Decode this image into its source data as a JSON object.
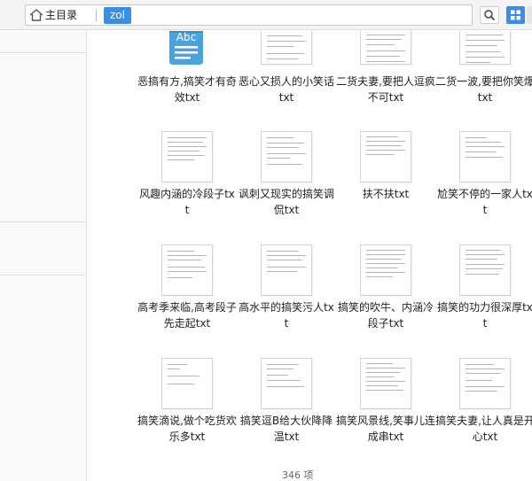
{
  "toolbar": {
    "home_icon": "home-icon",
    "crumb_home": "主目录",
    "crumb_current": "zol",
    "search_icon": "search-icon",
    "view_icon": "grid-view-icon",
    "accent": "#3a8ee6"
  },
  "files": [
    {
      "name": "恶搞有方,搞笑才有奇效txt",
      "icon": "text-file-abc-icon"
    },
    {
      "name": "恶心又损人的小笑话txt",
      "icon": "text-file-thumbnail"
    },
    {
      "name": "二货夫妻,要把人逗疯不可txt",
      "icon": "text-file-thumbnail"
    },
    {
      "name": "二货一波,要把你笑爆txt",
      "icon": "text-file-thumbnail"
    },
    {
      "name": "风趣内涵的冷段子txt",
      "icon": "text-file-thumbnail"
    },
    {
      "name": "讽刺又现实的搞笑调侃txt",
      "icon": "text-file-thumbnail"
    },
    {
      "name": "扶不扶txt",
      "icon": "text-file-thumbnail"
    },
    {
      "name": "尬笑不停的一家人txt",
      "icon": "text-file-thumbnail"
    },
    {
      "name": "高考季来临,高考段子先走起txt",
      "icon": "text-file-thumbnail"
    },
    {
      "name": "高水平的搞笑污人txt",
      "icon": "text-file-thumbnail"
    },
    {
      "name": "搞笑的吹牛、内涵冷段子txt",
      "icon": "text-file-thumbnail"
    },
    {
      "name": "搞笑的功力很深厚txt",
      "icon": "text-file-thumbnail"
    },
    {
      "name": "搞笑滴说,做个吃货欢乐多txt",
      "icon": "text-file-thumbnail"
    },
    {
      "name": "搞笑逗B给大伙降降温txt",
      "icon": "text-file-thumbnail"
    },
    {
      "name": "搞笑风景线,笑事儿连成串txt",
      "icon": "text-file-thumbnail"
    },
    {
      "name": "搞笑夫妻,让人真是开心txt",
      "icon": "text-file-thumbnail"
    }
  ],
  "status": {
    "count": "346 项"
  }
}
